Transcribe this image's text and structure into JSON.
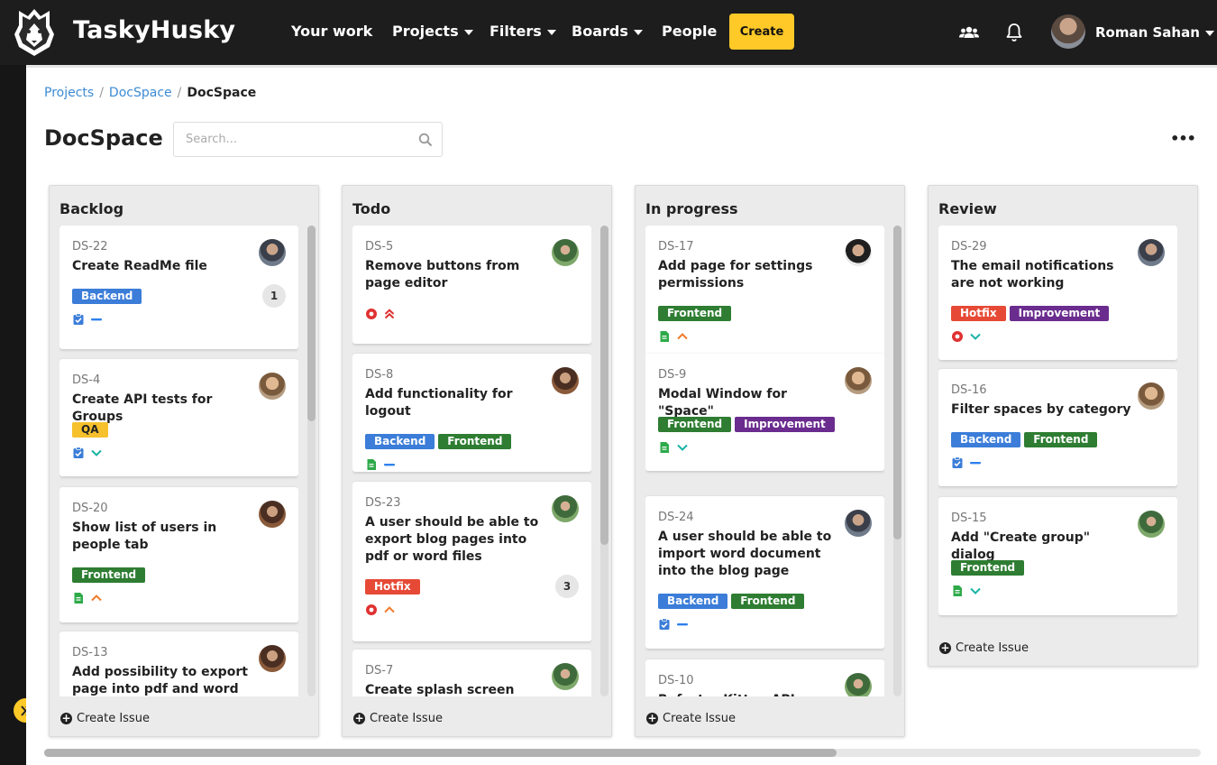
{
  "app": {
    "brand": "TaskyHusky"
  },
  "nav": {
    "your_work": "Your work",
    "projects": "Projects",
    "filters": "Filters",
    "boards": "Boards",
    "people": "People",
    "create": "Create",
    "user_name": "Roman Sahan"
  },
  "breadcrumb": {
    "projects": "Projects",
    "project": "DocSpace",
    "current": "DocSpace"
  },
  "page": {
    "title": "DocSpace",
    "search_placeholder": "Search...",
    "more": "•••"
  },
  "colors": {
    "accent": "#ffc928",
    "backend": "#3b7dd8",
    "frontend": "#2e7d32",
    "qa": "#f6c12c",
    "hotfix": "#e64a36",
    "improvement": "#6a2c8e"
  },
  "create_issue_label": "Create Issue",
  "columns": [
    {
      "title": "Backlog",
      "cards": [
        {
          "key": "DS-22",
          "title": "Create ReadMe file",
          "tags": [
            "Backend"
          ],
          "type": "task",
          "priority": "medium",
          "count": "1"
        },
        {
          "key": "DS-4",
          "title": "Create API tests for Groups",
          "tags": [
            "QA"
          ],
          "type": "task",
          "priority": "low",
          "count": ""
        },
        {
          "key": "DS-20",
          "title": "Show list of users in people tab",
          "tags": [
            "Frontend"
          ],
          "type": "story",
          "priority": "high",
          "count": ""
        },
        {
          "key": "DS-13",
          "title": "Add possibility to export page into pdf and word",
          "tags": [],
          "type": "",
          "priority": "",
          "count": ""
        }
      ]
    },
    {
      "title": "Todo",
      "cards": [
        {
          "key": "DS-5",
          "title": "Remove buttons from page editor",
          "tags": [],
          "type": "bug",
          "priority": "highest",
          "count": ""
        },
        {
          "key": "DS-8",
          "title": "Add functionality for logout",
          "tags": [
            "Backend",
            "Frontend"
          ],
          "type": "story",
          "priority": "medium",
          "count": ""
        },
        {
          "key": "DS-23",
          "title": "A user should be able to export blog pages into pdf or word files",
          "tags": [
            "Hotfix"
          ],
          "type": "bug",
          "priority": "high",
          "count": "3"
        },
        {
          "key": "DS-7",
          "title": "Create splash screen",
          "tags": [],
          "type": "",
          "priority": "",
          "count": ""
        }
      ]
    },
    {
      "title": "In progress",
      "cards": [
        {
          "key": "DS-17",
          "title": "Add page for settings permissions",
          "tags": [
            "Frontend"
          ],
          "type": "story",
          "priority": "high",
          "count": ""
        },
        {
          "key": "DS-9",
          "title": "Modal Window for \"Space\"",
          "tags": [
            "Frontend",
            "Improvement"
          ],
          "type": "story",
          "priority": "low",
          "count": ""
        },
        {
          "key": "DS-24",
          "title": "A user should be able to import word document into the blog page",
          "tags": [
            "Backend",
            "Frontend"
          ],
          "type": "task",
          "priority": "medium",
          "count": ""
        },
        {
          "key": "DS-10",
          "title": "Refactor Kitten API",
          "tags": [],
          "type": "",
          "priority": "",
          "count": ""
        }
      ]
    },
    {
      "title": "Review",
      "cards": [
        {
          "key": "DS-29",
          "title": "The email notifications are not working",
          "tags": [
            "Hotfix",
            "Improvement"
          ],
          "type": "bug",
          "priority": "low",
          "count": ""
        },
        {
          "key": "DS-16",
          "title": "Filter spaces by category",
          "tags": [
            "Backend",
            "Frontend"
          ],
          "type": "task",
          "priority": "medium",
          "count": ""
        },
        {
          "key": "DS-15",
          "title": "Add \"Create group\" dialog",
          "tags": [
            "Frontend"
          ],
          "type": "story",
          "priority": "low",
          "count": ""
        }
      ]
    }
  ]
}
